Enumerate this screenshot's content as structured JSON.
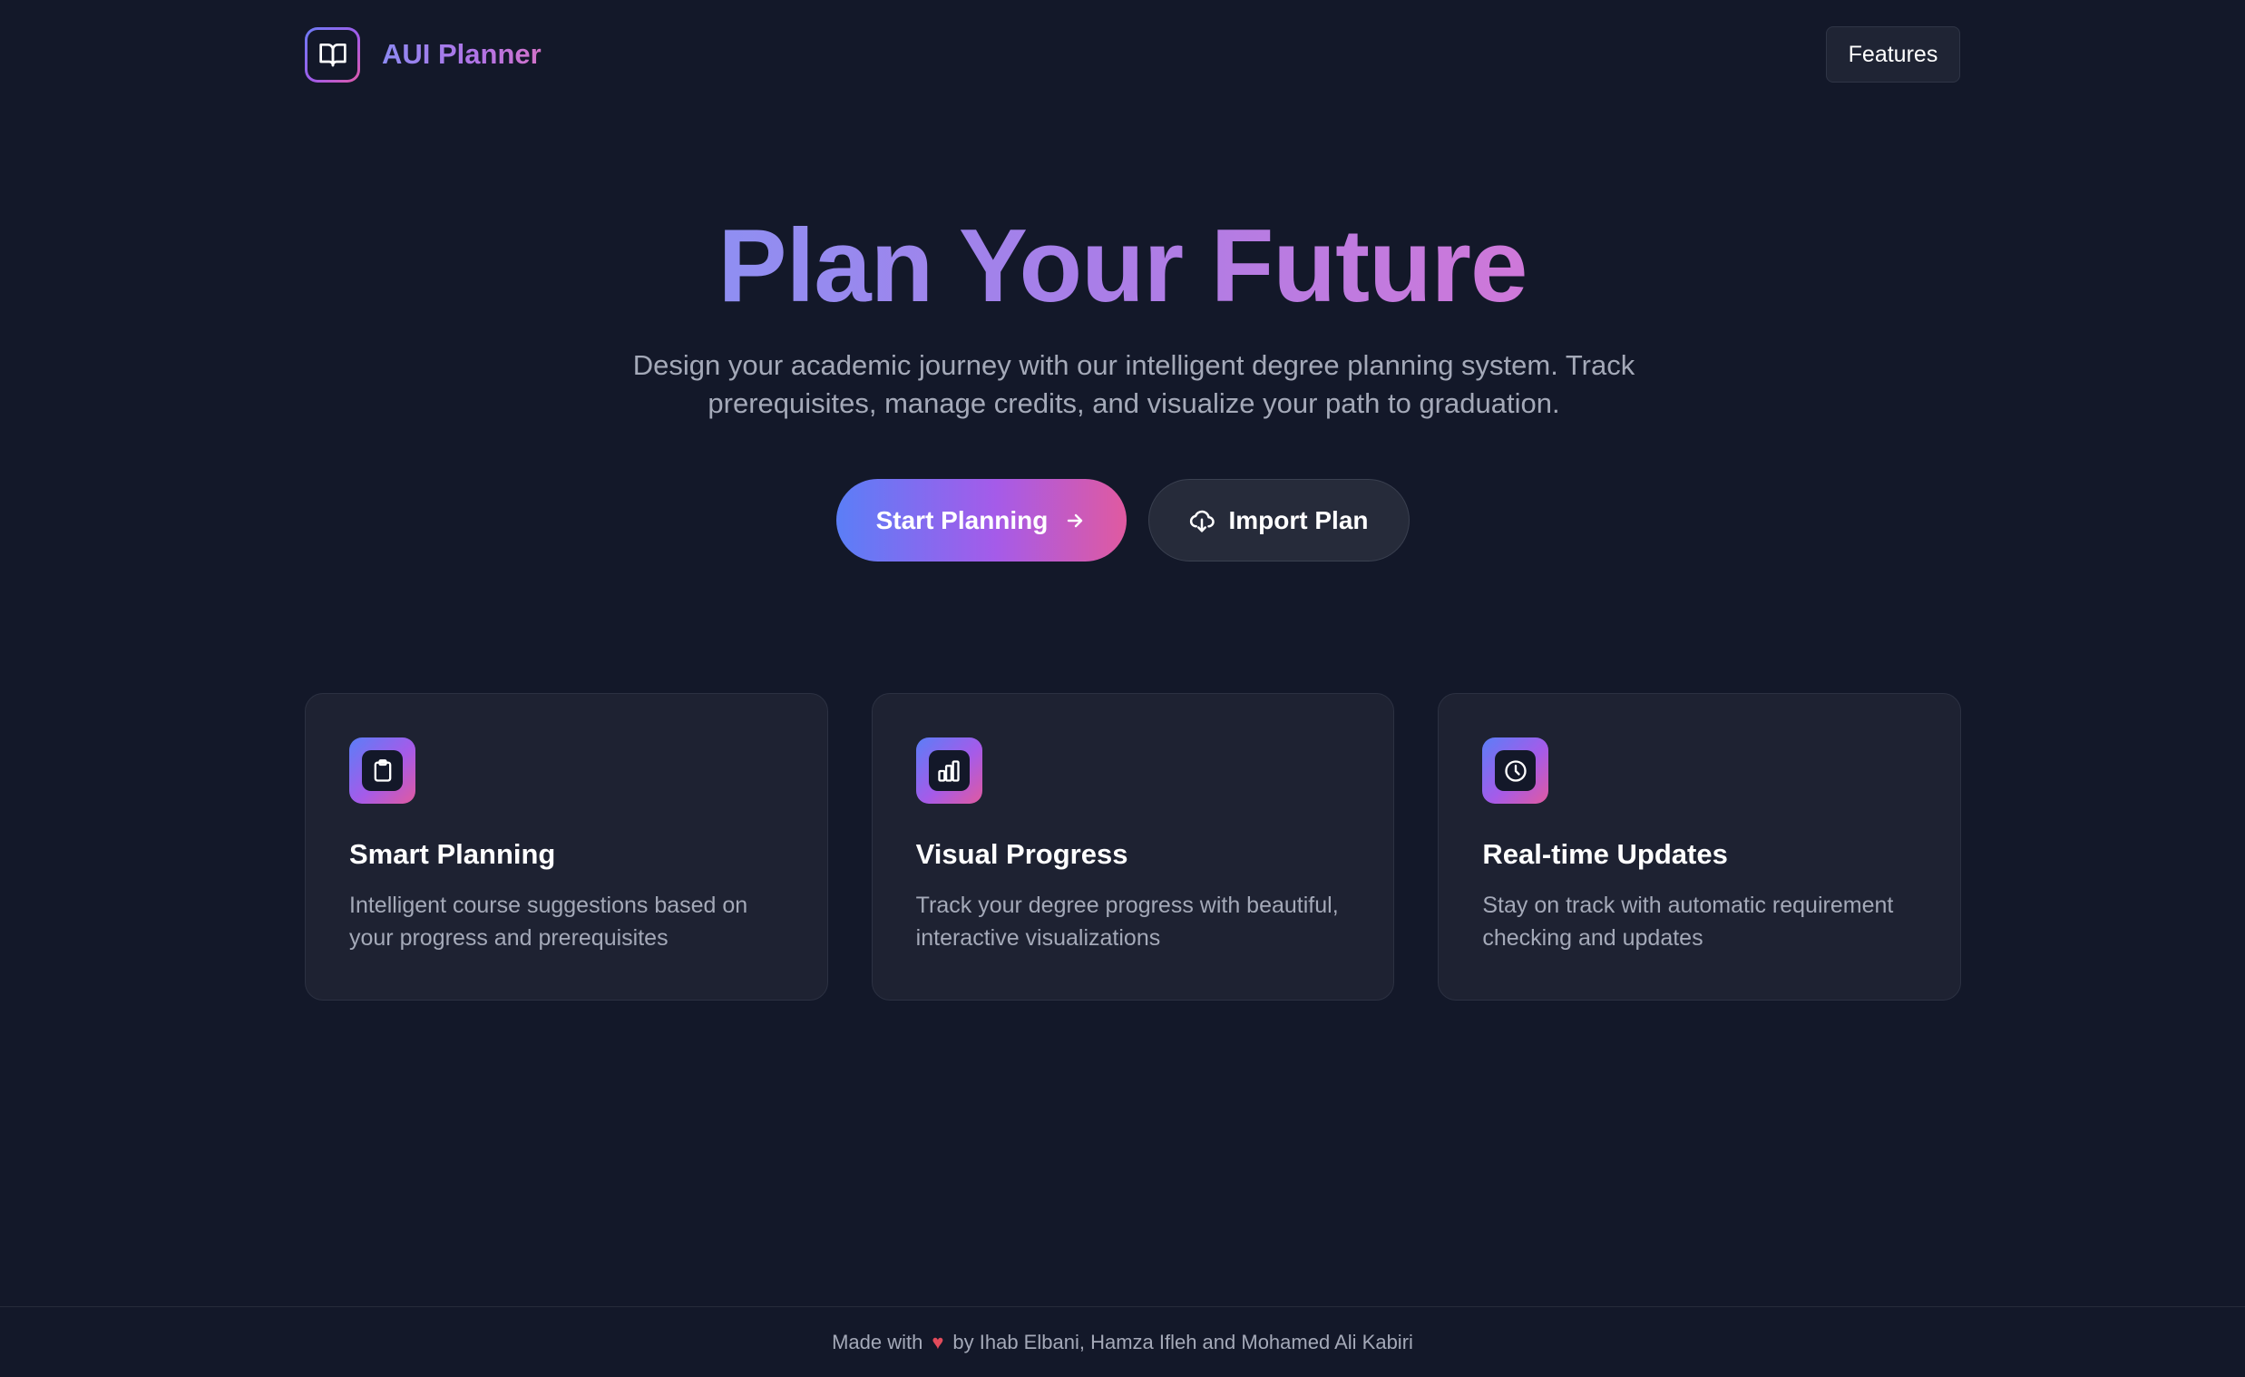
{
  "header": {
    "brand_name": "AUI Planner",
    "logo_icon": "open-book-icon",
    "features_label": "Features"
  },
  "hero": {
    "title": "Plan Your Future",
    "subtitle": "Design your academic journey with our intelligent degree planning system. Track prerequisites, manage credits, and visualize your path to graduation.",
    "primary_cta": "Start Planning",
    "primary_cta_icon": "arrow-right-icon",
    "secondary_cta": "Import Plan",
    "secondary_cta_icon": "cloud-download-icon"
  },
  "features": [
    {
      "icon": "clipboard-icon",
      "title": "Smart Planning",
      "description": "Intelligent course suggestions based on your progress and prerequisites"
    },
    {
      "icon": "bar-chart-icon",
      "title": "Visual Progress",
      "description": "Track your degree progress with beautiful, interactive visualizations"
    },
    {
      "icon": "clock-icon",
      "title": "Real-time Updates",
      "description": "Stay on track with automatic requirement checking and updates"
    }
  ],
  "footer": {
    "made_with": "Made with",
    "heart": "♥",
    "authors": "by Ihab Elbani, Hamza Ifleh and Mohamed Ali Kabiri"
  },
  "colors": {
    "background": "#131829",
    "card": "#1e2232",
    "gradient_start": "#5b7ef7",
    "gradient_mid": "#a55be9",
    "gradient_end": "#e05aa0",
    "muted_text": "#a4a9b8"
  }
}
